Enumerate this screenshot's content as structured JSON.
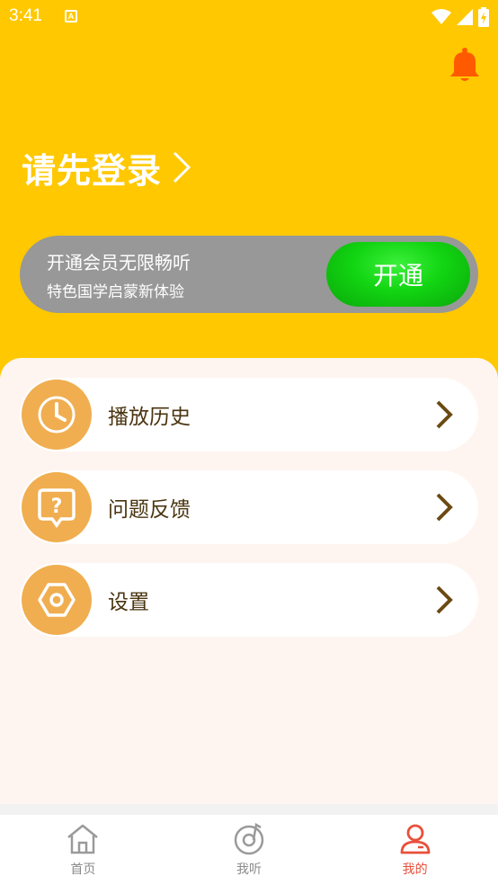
{
  "status_bar": {
    "time": "3:41",
    "a_icon": "A"
  },
  "header": {
    "login_text": "请先登录",
    "bell_color": "#ff5a00"
  },
  "vip": {
    "line1": "开通会员无限畅听",
    "line2": "特色国学启蒙新体验",
    "button_label": "开通"
  },
  "menu": {
    "items": [
      {
        "label": "播放历史",
        "icon": "clock-icon"
      },
      {
        "label": "问题反馈",
        "icon": "feedback-icon"
      },
      {
        "label": "设置",
        "icon": "settings-icon"
      }
    ]
  },
  "tabbar": {
    "tabs": [
      {
        "label": "首页",
        "icon": "home-icon",
        "active": false
      },
      {
        "label": "我听",
        "icon": "listen-icon",
        "active": false
      },
      {
        "label": "我的",
        "icon": "profile-icon",
        "active": true
      }
    ]
  },
  "colors": {
    "header": "#ffc800",
    "accent_orange": "#f0ae50",
    "button_green": "#12d412",
    "active_tab": "#e8503a"
  }
}
